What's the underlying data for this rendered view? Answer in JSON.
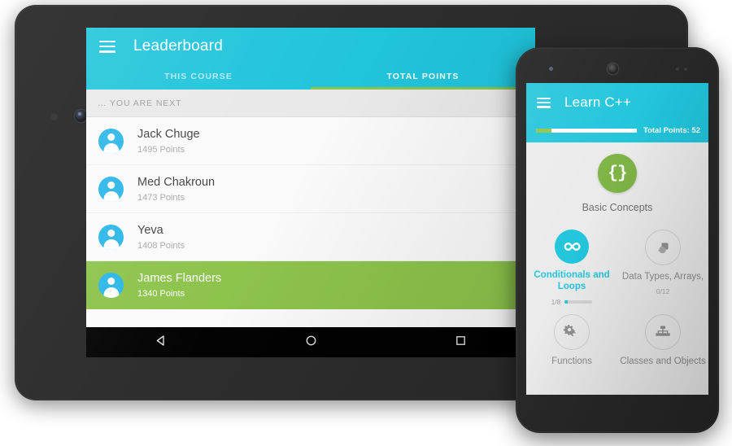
{
  "tablet": {
    "appbar": {
      "menu_icon": "hamburger-menu-icon",
      "title": "Leaderboard"
    },
    "tabs": [
      {
        "label": "THIS COURSE",
        "active": false
      },
      {
        "label": "TOTAL POINTS",
        "active": true
      }
    ],
    "subheader": "… YOU ARE NEXT",
    "list": [
      {
        "name": "Jack Chuge",
        "points": "1495 Points",
        "highlighted": false
      },
      {
        "name": "Med Chakroun",
        "points": "1473 Points",
        "highlighted": false
      },
      {
        "name": "Yeva",
        "points": "1408 Points",
        "highlighted": false
      },
      {
        "name": "James Flanders",
        "points": "1340 Points",
        "highlighted": true
      }
    ],
    "navbar": [
      {
        "icon": "back-triangle-icon"
      },
      {
        "icon": "home-circle-icon"
      },
      {
        "icon": "recents-square-icon"
      }
    ]
  },
  "phone": {
    "appbar": {
      "menu_icon": "hamburger-menu-icon",
      "title": "Learn C++"
    },
    "progress": {
      "percent": 15,
      "points_label": "Total Points: 52"
    },
    "hero": {
      "icon": "curly-braces-icon",
      "glyph": "{}",
      "label": "Basic Concepts"
    },
    "tiles": [
      {
        "label": "Conditionals and Loops",
        "icon": "infinity-icon",
        "state": "active",
        "progress_text": "1/8",
        "progress_percent": 12,
        "show_bar": true
      },
      {
        "label": "Data Types, Arrays,",
        "icon": "data-shapes-icon",
        "state": "locked",
        "progress_text": "0/12",
        "progress_percent": 0,
        "show_bar": false
      },
      {
        "label": "Functions",
        "icon": "gears-icon",
        "state": "locked",
        "progress_text": "",
        "progress_percent": 0,
        "show_bar": false
      },
      {
        "label": "Classes and Objects",
        "icon": "hierarchy-icon",
        "state": "locked",
        "progress_text": "",
        "progress_percent": 0,
        "show_bar": false
      }
    ]
  },
  "colors": {
    "teal": "#1ec4db",
    "green": "#8bc34a",
    "hero_green": "#7cb342",
    "avatar_blue": "#29b6e8",
    "body_grey": "#ebebeb"
  }
}
